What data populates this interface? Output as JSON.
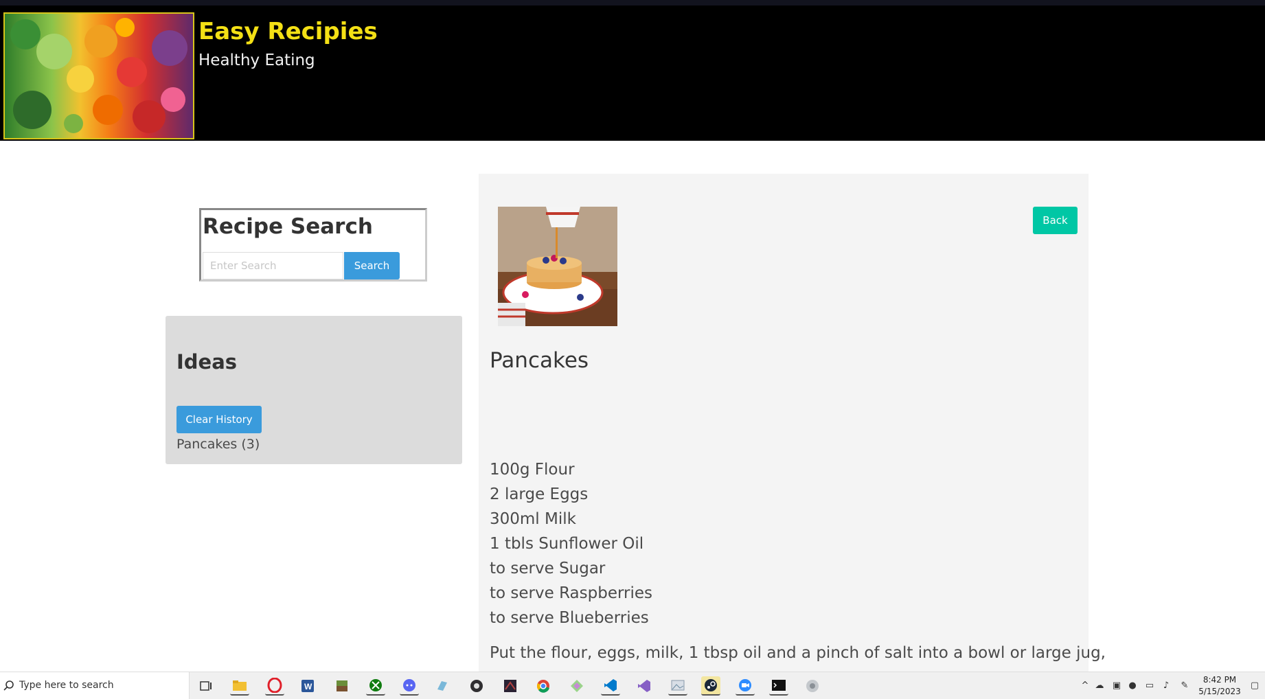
{
  "header": {
    "title": "Easy Recipies",
    "subtitle": "Healthy Eating",
    "logo_icon": "vegetables-image",
    "colors": {
      "background": "#000000",
      "title": "#f4e015",
      "border": "#d8c51a"
    }
  },
  "search": {
    "title": "Recipe Search",
    "placeholder": "Enter Search",
    "value": "",
    "button_label": "Search"
  },
  "ideas": {
    "title": "Ideas",
    "clear_button_label": "Clear History",
    "history": [
      "Pancakes (3)"
    ]
  },
  "recipe": {
    "image_icon": "pancakes-image",
    "back_label": "Back",
    "title": "Pancakes",
    "ingredients": [
      "100g Flour",
      "2 large Eggs",
      "300ml Milk",
      "1 tbls Sunflower Oil",
      "to serve Sugar",
      "to serve Raspberries",
      "to serve Blueberries"
    ],
    "method_preview": "Put the flour, eggs, milk, 1 tbsp oil and a pinch of salt into a bowl or large jug,"
  },
  "taskbar": {
    "search_placeholder": "Type here to search",
    "time": "8:42 PM",
    "date": "5/15/2023",
    "apps": [
      "task-view-icon",
      "file-explorer-icon",
      "opera-icon",
      "word-icon",
      "minecraft-icon",
      "xbox-icon",
      "discord-icon",
      "app-icon",
      "obs-icon",
      "game-icon",
      "chrome-icon",
      "app-icon",
      "vscode-icon",
      "visual-studio-icon",
      "photos-icon",
      "steam-icon",
      "zoom-icon",
      "terminal-icon",
      "app-icon"
    ]
  },
  "colors": {
    "button_blue": "#3a9bdc",
    "button_teal": "#00c7a5",
    "panel_gray": "#dcdcdc",
    "recipe_bg": "#f4f4f4"
  }
}
